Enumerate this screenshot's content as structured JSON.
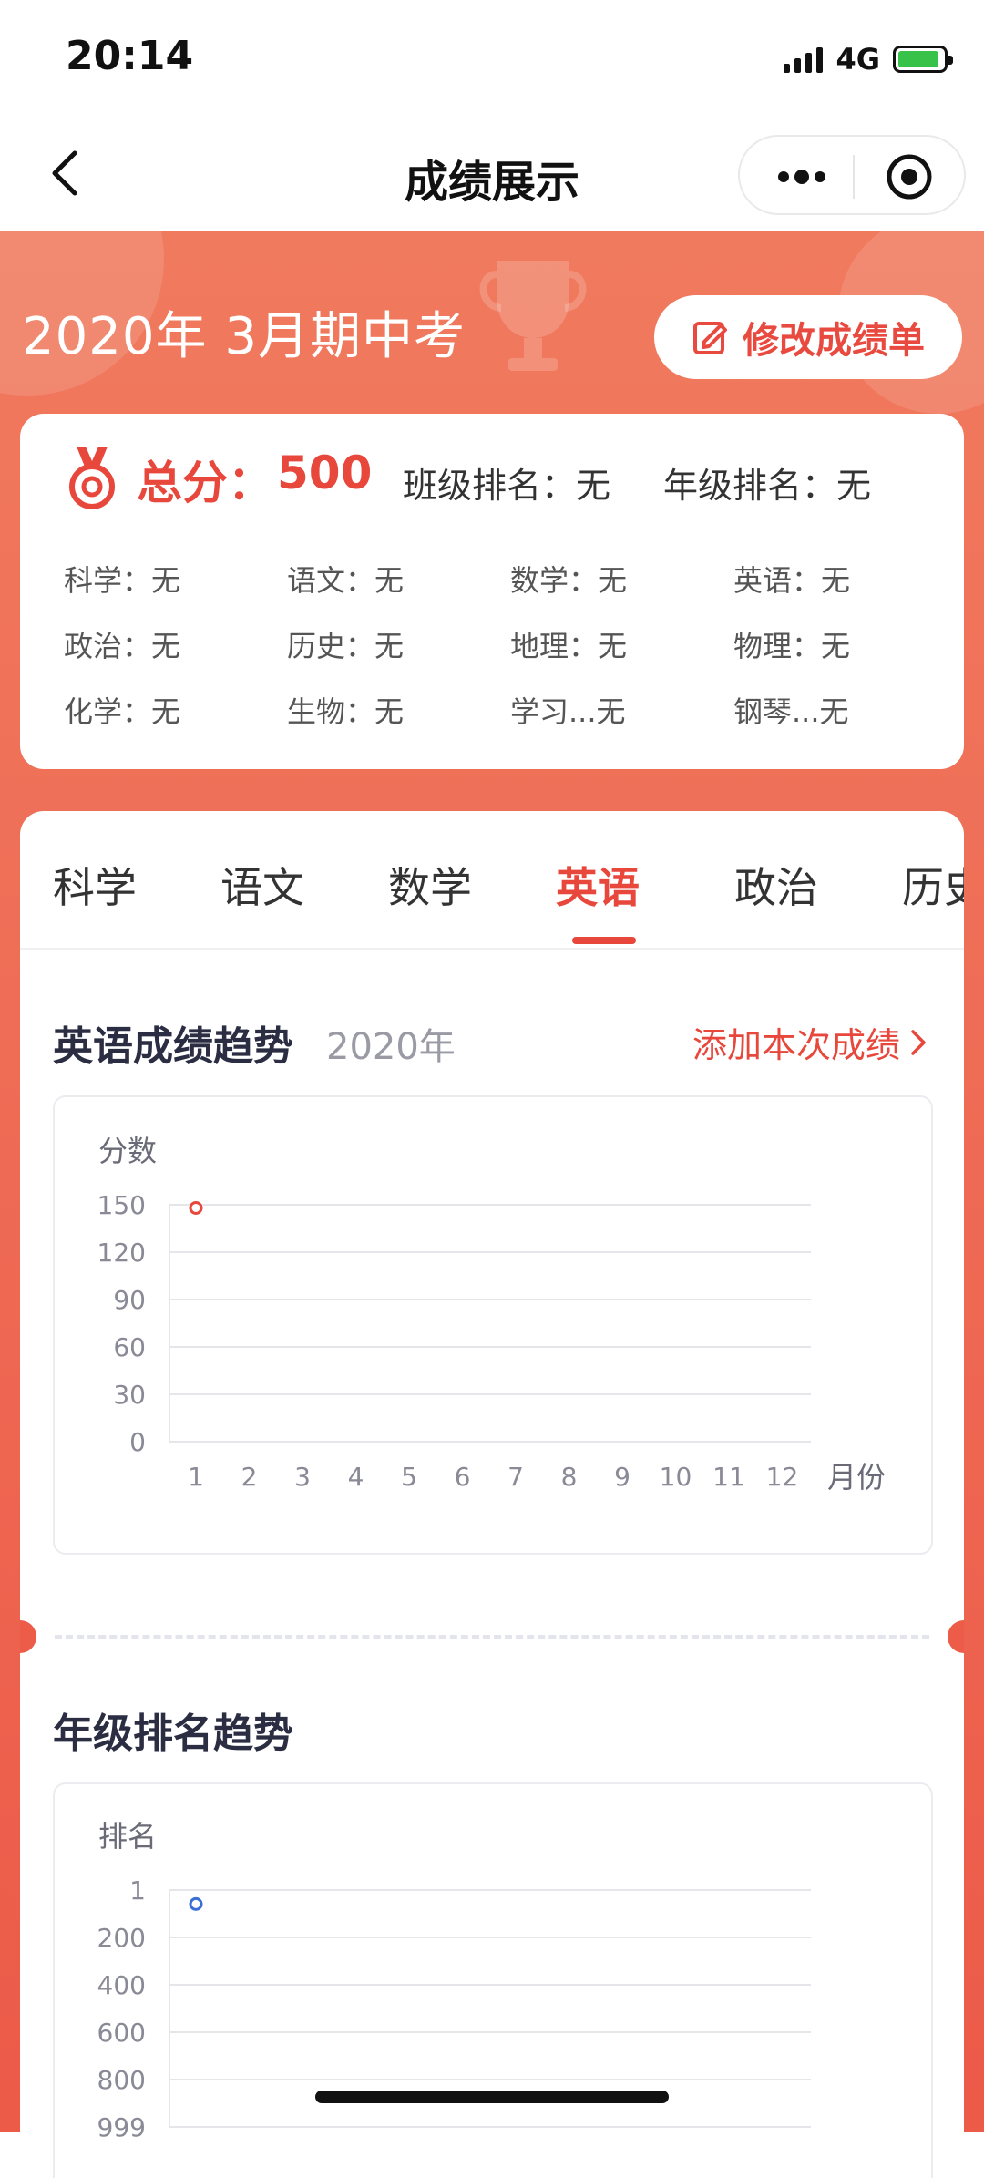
{
  "status": {
    "time": "20:14",
    "network": "4G"
  },
  "nav": {
    "title": "成绩展示"
  },
  "header": {
    "exam_title": "2020年  3月期中考",
    "edit_button": "修改成绩单"
  },
  "summary": {
    "total_label": "总分：",
    "total_value": "500",
    "class_rank": "班级排名：无",
    "grade_rank": "年级排名：无",
    "subjects": [
      "科学：无",
      "语文：无",
      "数学：无",
      "英语：无",
      "政治：无",
      "历史：无",
      "地理：无",
      "物理：无",
      "化学：无",
      "生物：无",
      "学习...无",
      "钢琴...无"
    ]
  },
  "tabs": [
    "科学",
    "语文",
    "数学",
    "英语",
    "政治",
    "历史"
  ],
  "active_tab": "英语",
  "trend": {
    "title": "英语成绩趋势",
    "year": "2020年",
    "add_link": "添加本次成绩"
  },
  "rank_trend": {
    "title": "年级排名趋势"
  },
  "colors": {
    "accent": "#e8473c",
    "score_point": "#e8473c",
    "rank_point": "#3b6fd8"
  },
  "chart_data": [
    {
      "type": "scatter",
      "ylabel": "分数",
      "xlabel": "月份",
      "x_ticks": [
        "1",
        "2",
        "3",
        "4",
        "5",
        "6",
        "7",
        "8",
        "9",
        "10",
        "11",
        "12"
      ],
      "y_ticks": [
        "150",
        "120",
        "90",
        "60",
        "30",
        "0"
      ],
      "ylim": [
        0,
        150
      ],
      "points": [
        {
          "x": 1,
          "y": 148
        }
      ],
      "grid": true
    },
    {
      "type": "scatter",
      "ylabel": "排名",
      "y_ticks": [
        "1",
        "200",
        "400",
        "600",
        "800",
        "999"
      ],
      "ylim": [
        1,
        999
      ],
      "y_reversed": true,
      "points": [
        {
          "x": 1,
          "y": 60
        }
      ],
      "grid": true
    }
  ]
}
